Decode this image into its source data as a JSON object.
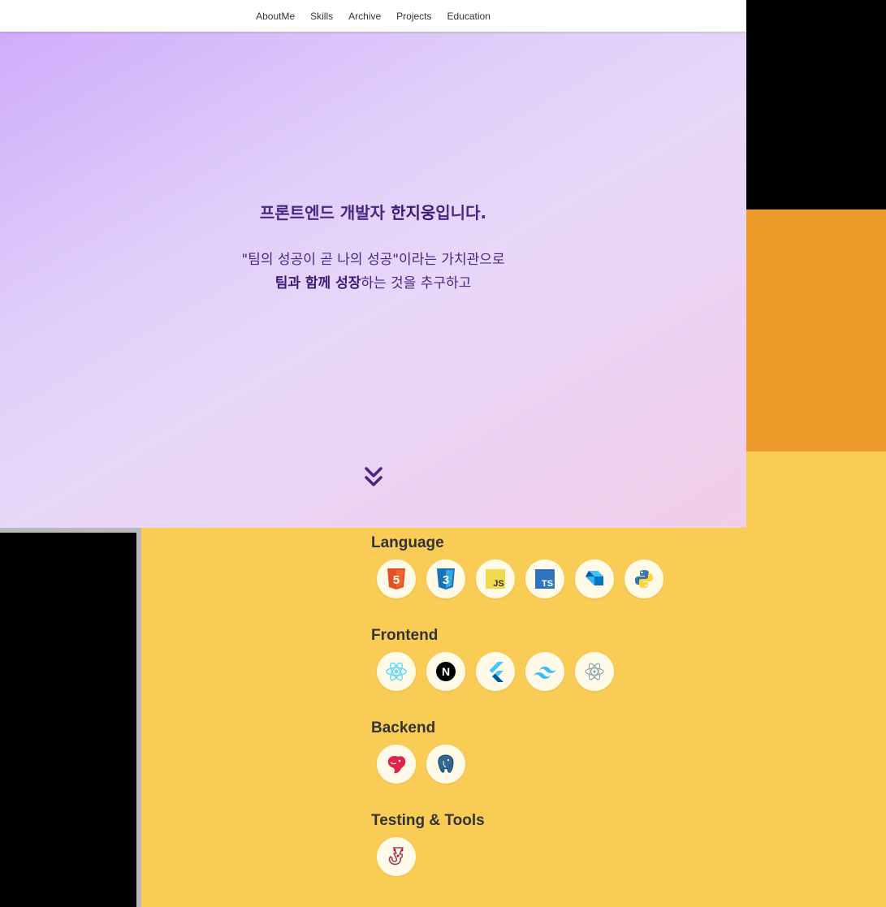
{
  "nav": {
    "items": [
      {
        "label": "AboutMe"
      },
      {
        "label": "Skills"
      },
      {
        "label": "Archive"
      },
      {
        "label": "Projects"
      },
      {
        "label": "Education"
      }
    ]
  },
  "hero": {
    "title_prefix": "프론트엔드 개발자 ",
    "title_name": "한지웅",
    "title_suffix": "입니다.",
    "line1": "\"팀의 성공이 곧 나의 성공\"이라는 가치관으로",
    "line2_bold": "팀과 함께 성장",
    "line2_rest": "하는 것을 추구하고",
    "accent_color": "#4b2584"
  },
  "skills": {
    "categories": [
      {
        "title": "Language",
        "icons": [
          "html5-icon",
          "css3-icon",
          "javascript-icon",
          "typescript-icon",
          "dart-icon",
          "python-icon"
        ]
      },
      {
        "title": "Frontend",
        "icons": [
          "react-icon",
          "nextjs-icon",
          "flutter-icon",
          "tailwindcss-icon",
          "electron-icon"
        ]
      },
      {
        "title": "Backend",
        "icons": [
          "nestjs-icon",
          "postgresql-icon"
        ]
      },
      {
        "title": "Testing & Tools",
        "icons": [
          "jest-icon"
        ]
      }
    ],
    "icon_texts": {
      "js": "JS",
      "ts": "TS",
      "next": "N",
      "html_num": "5",
      "css_num": "3"
    },
    "background_color": "#f9cc55"
  }
}
